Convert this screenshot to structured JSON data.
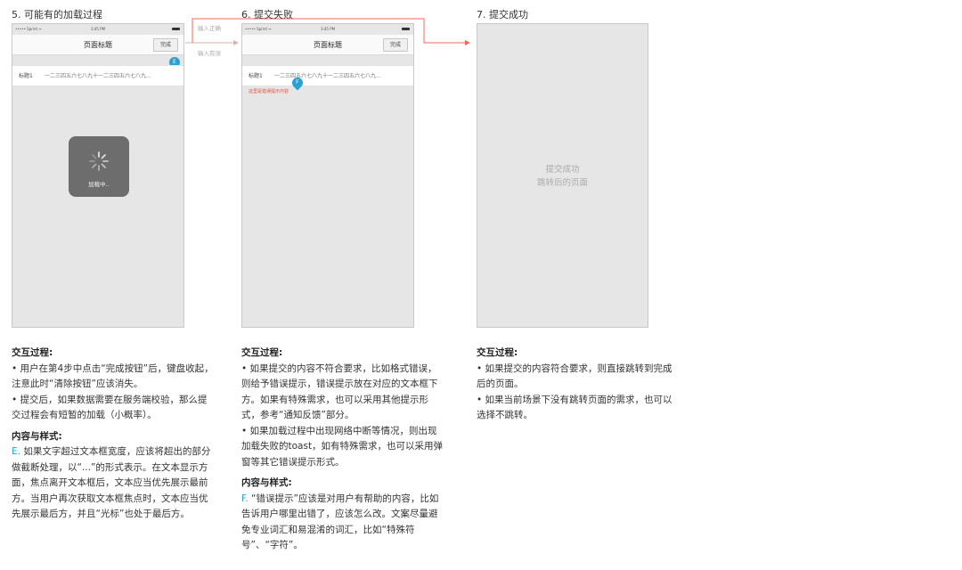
{
  "sections": [
    {
      "title": "5. 可能有的加载过程",
      "phone": {
        "carrier": "••••• Sprint ᯤ",
        "time": "3:45 PM",
        "nav_title": "页面标题",
        "done_label": "完成",
        "row_label": "标题1",
        "row_value": "一二三四五六七八九十一二三四五六七八九...",
        "pin_letter": "E",
        "loading_label": "加载中.."
      },
      "notes": {
        "interaction_heading": "交互过程:",
        "interaction_items": [
          "• 用户在第4步中点击“完成按钮”后，键盘收起，注意此时“清除按钮”应该消失。",
          "• 提交后，如果数据需要在服务端校验，那么提交过程会有短暂的加载（小概率）。"
        ],
        "style_heading": "内容与样式:",
        "style_letter": "E.",
        "style_text": " 如果文字超过文本框宽度，应该将超出的部分做截断处理，以“...”的形式表示。在文本显示方面，焦点离开文本框后，文本应当优先展示最前方。当用户再次获取文本框焦点时，文本应当优先展示最后方，并且“光标”也处于最后方。"
      }
    },
    {
      "title": "6. 提交失败",
      "phone": {
        "carrier": "••••• Sprint ᯤ",
        "time": "3:45 PM",
        "nav_title": "页面标题",
        "done_label": "完成",
        "row_label": "标题1",
        "row_value": "一二三四五六七八九十一二三四五六七八九...",
        "pin_letter": "F",
        "error_tip": "这里是错误提示内容"
      },
      "notes": {
        "interaction_heading": "交互过程:",
        "interaction_items": [
          "• 如果提交的内容不符合要求，比如格式错误，则给予错误提示，错误提示放在对应的文本框下方。如果有特殊需求，也可以采用其他提示形式，参考“通知反馈”部分。",
          "• 如果加载过程中出现网络中断等情况，则出现加载失败的toast，如有特殊需求，也可以采用弹窗等其它错误提示形式。"
        ],
        "style_heading": "内容与样式:",
        "style_letter": "F.",
        "style_text": " “错误提示”应该是对用户有帮助的内容，比如告诉用户哪里出错了，应该怎么改。文案尽量避免专业词汇和易混淆的词汇，比如“特殊符号”、“字符”。"
      }
    },
    {
      "title": "7. 提交成功",
      "phone": {
        "center_line1": "提交成功",
        "center_line2": "跳转后的页面"
      },
      "notes": {
        "interaction_heading": "交互过程:",
        "interaction_items": [
          "• 如果提交的内容符合要求，则直接跳转到完成后的页面。",
          "• 如果当前场景下没有跳转页面的需求，也可以选择不跳转。"
        ]
      }
    }
  ],
  "flow_labels": {
    "correct": "输入正确",
    "wrong": "输入有误"
  },
  "colors": {
    "accent_blue": "#2aa1d3",
    "error_red": "#e0513d",
    "flow_arrow": "#f06a5a"
  }
}
